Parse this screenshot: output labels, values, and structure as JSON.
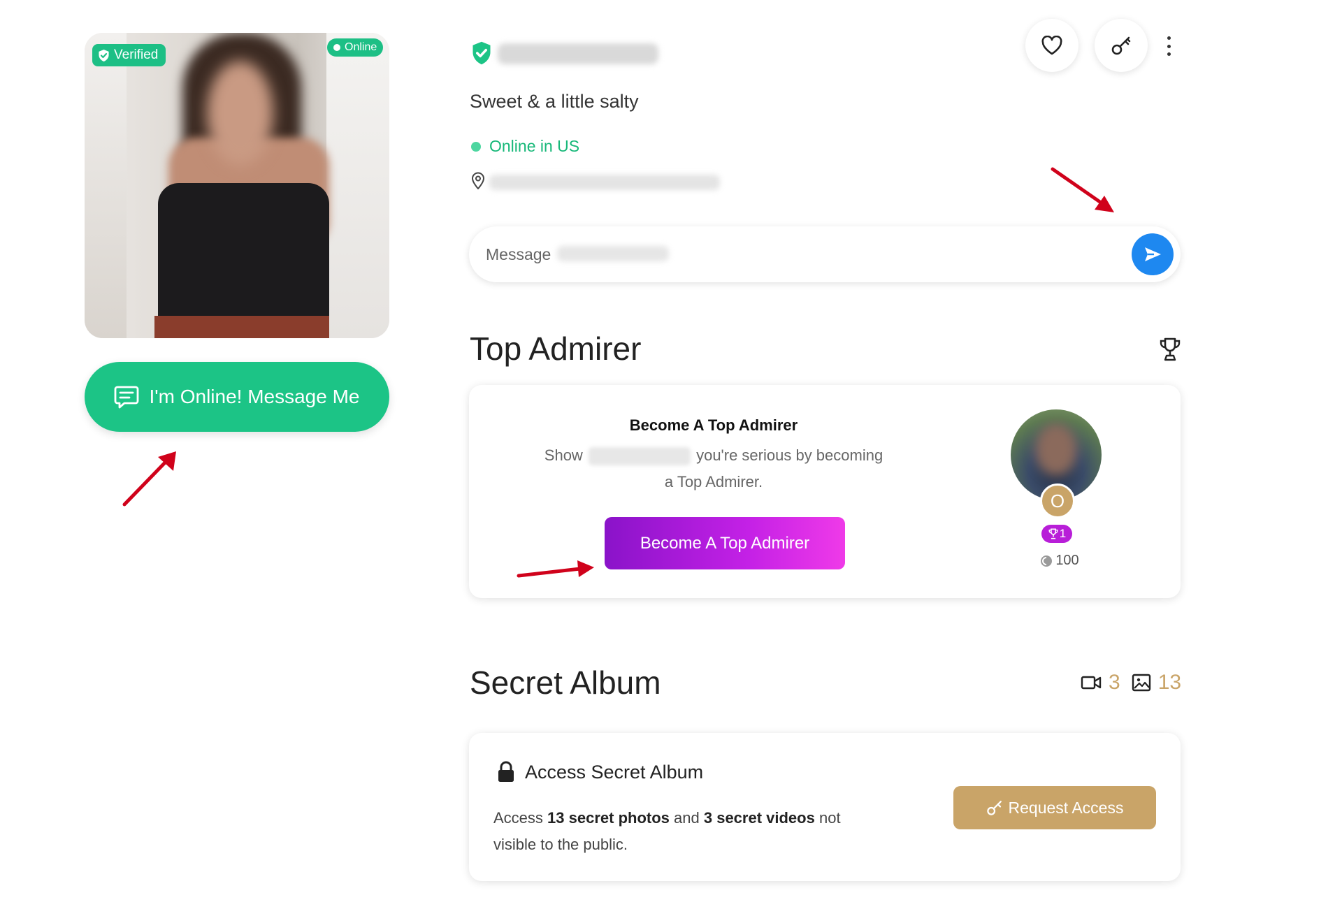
{
  "profile": {
    "verified_label": "Verified",
    "online_label": "Online",
    "tagline": "Sweet & a little salty",
    "status": "Online in US",
    "cta_label": "I'm Online! Message Me"
  },
  "message": {
    "placeholder": "Message"
  },
  "top_admirer": {
    "heading": "Top Admirer",
    "card_title": "Become A Top Admirer",
    "desc_prefix": "Show",
    "desc_suffix": "you're serious by becoming",
    "desc_line2": "a Top Admirer.",
    "button_label": "Become A Top Admirer",
    "avatar_initial": "O",
    "rank": "1",
    "points": "100"
  },
  "secret_album": {
    "heading": "Secret Album",
    "video_count": "3",
    "photo_count": "13",
    "card_title": "Access Secret Album",
    "desc_part1": "Access",
    "desc_bold1": "13 secret photos",
    "desc_part2": "and",
    "desc_bold2": "3 secret videos",
    "desc_part3": "not visible to the public.",
    "button_label": "Request Access"
  },
  "colors": {
    "brand_green": "#1cc486",
    "send_blue": "#1e88f0",
    "gold": "#c9a468",
    "purple_gradient_start": "#8a13c9",
    "purple_gradient_end": "#ef3ae8",
    "annotation_red": "#d0021b"
  },
  "icons": [
    "shield-check-icon",
    "heart-icon",
    "key-icon",
    "more-vertical-icon",
    "map-pin-icon",
    "send-icon",
    "chat-icon",
    "trophy-icon",
    "video-icon",
    "image-icon",
    "lock-icon",
    "coin-icon"
  ]
}
